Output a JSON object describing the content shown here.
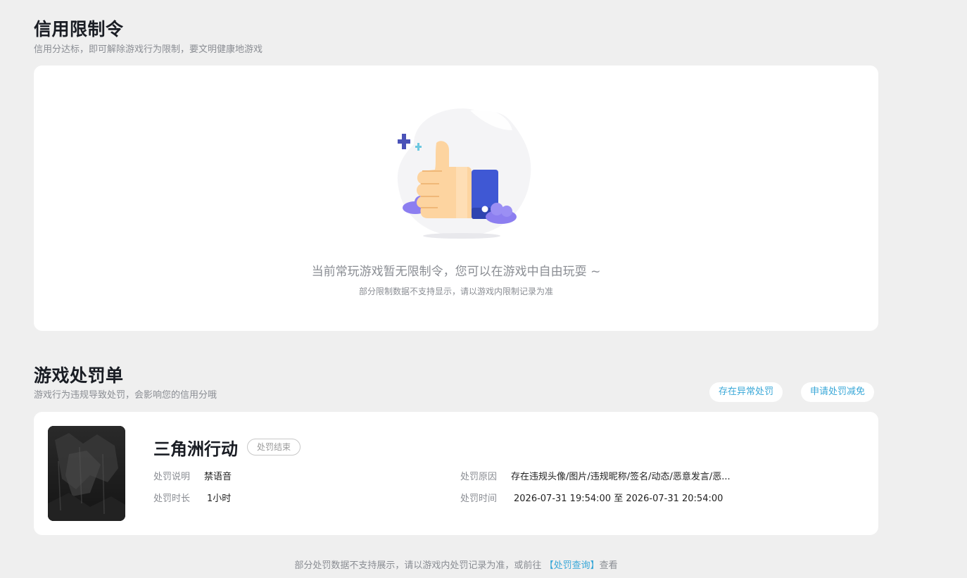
{
  "credit": {
    "title": "信用限制令",
    "subtitle": "信用分达标，即可解除游戏行为限制，要文明健康地游戏",
    "empty_main": "当前常玩游戏暂无限制令，您可以在游戏中自由玩耍 ~",
    "empty_sub": "部分限制数据不支持显示，请以游戏内限制记录为准"
  },
  "penalty": {
    "title": "游戏处罚单",
    "subtitle": "游戏行为违规导致处罚，会影响您的信用分哦",
    "buttons": {
      "abnormal": "存在异常处罚",
      "appeal": "申请处罚减免"
    },
    "record": {
      "game_name": "三角洲行动",
      "status": "处罚结束",
      "desc_label": "处罚说明",
      "desc_value": "禁语音",
      "duration_label": "处罚时长",
      "duration_value": "1小时",
      "reason_label": "处罚原因",
      "reason_value": "存在违规头像/图片/违规昵称/签名/动态/恶意发言/恶...",
      "time_label": "处罚时间",
      "time_value": "2026-07-31 19:54:00 至 2026-07-31 20:54:00"
    }
  },
  "footer": {
    "prefix": "部分处罚数据不支持展示，请以游戏内处罚记录为准，或前往",
    "link": "【处罚查询】",
    "suffix": "查看"
  },
  "colors": {
    "accent": "#3aa8d8",
    "background": "#efefef",
    "card": "#ffffff"
  },
  "icons": {
    "illustration": "thumbs-up-icon",
    "cover": "game-cover-image"
  }
}
